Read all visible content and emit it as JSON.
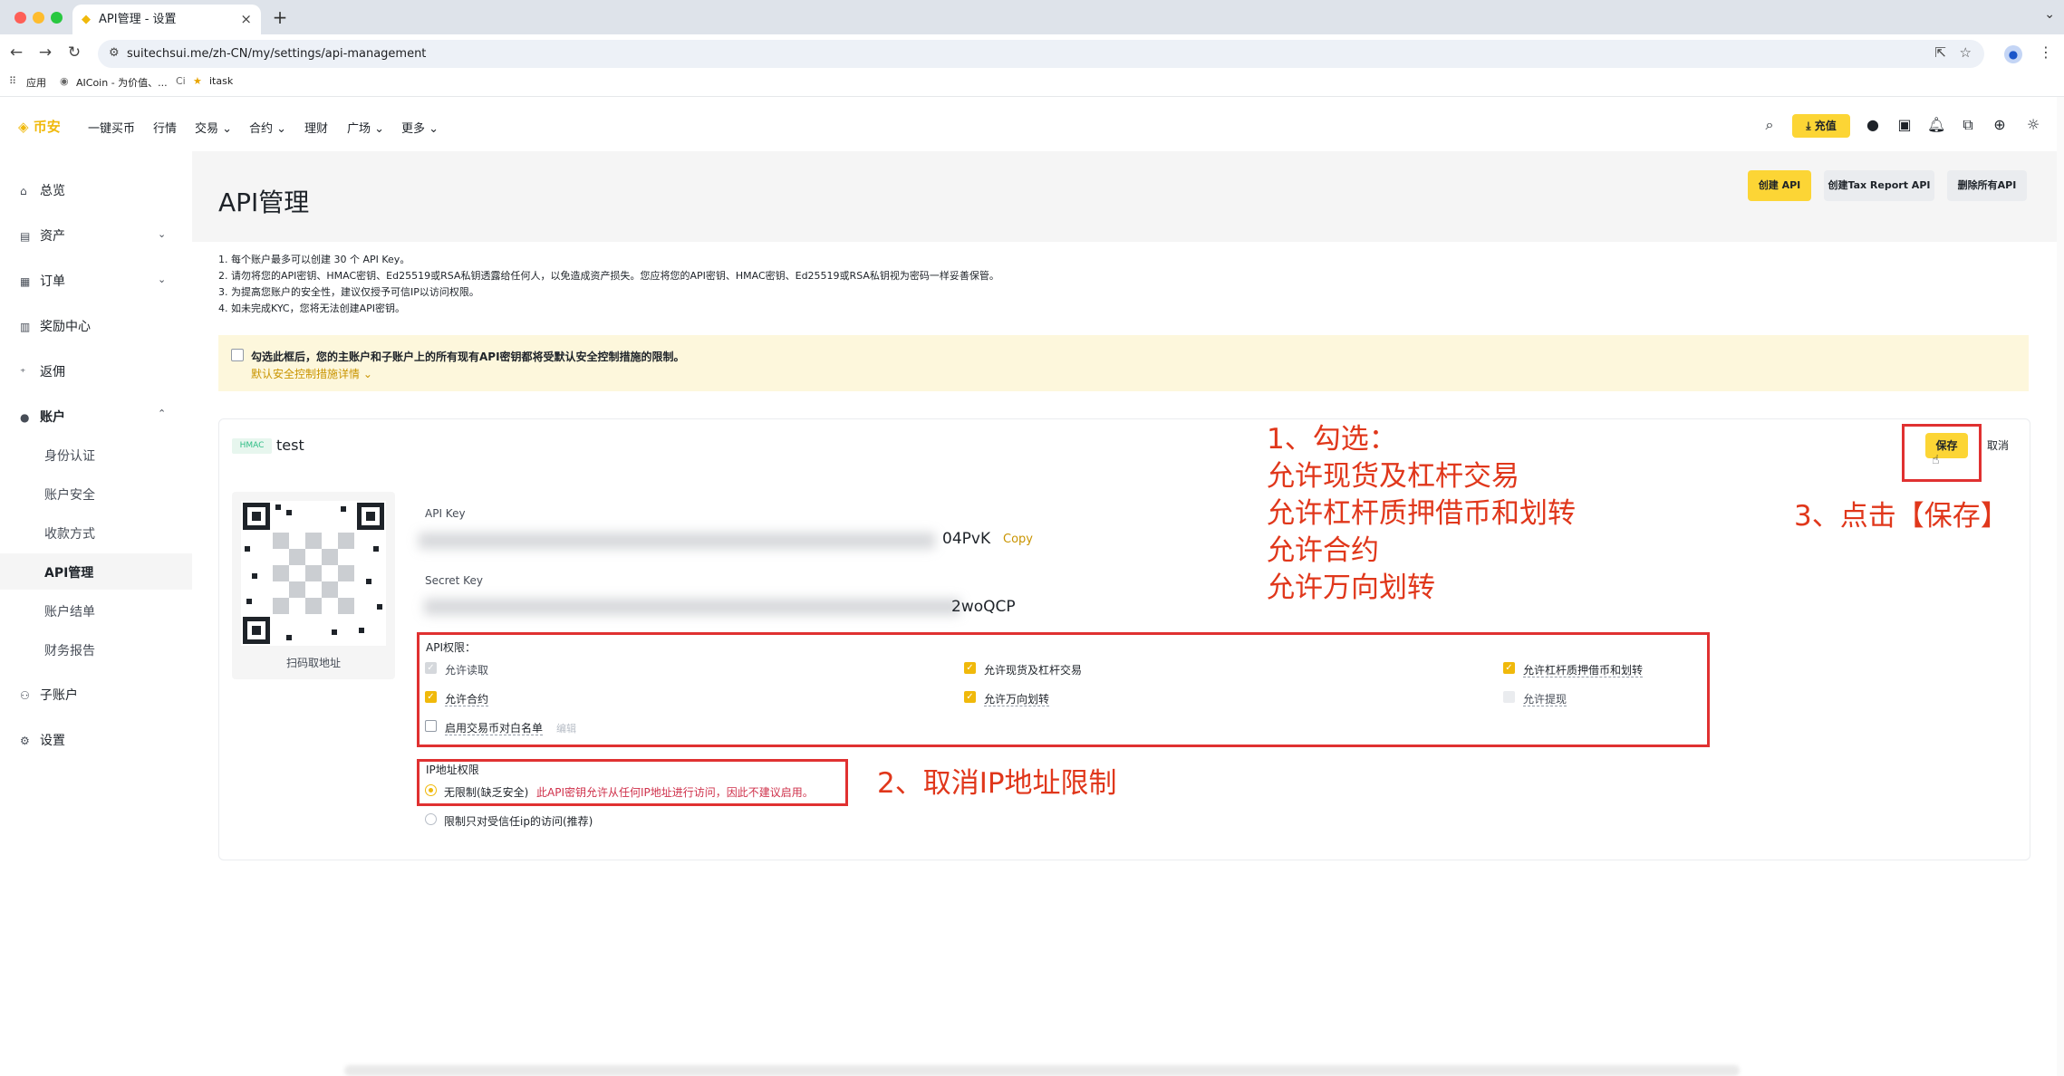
{
  "browser": {
    "tab_title": "API管理 - 设置",
    "url": "suitechsui.me/zh-CN/my/settings/api-management",
    "bookmarks": [
      "应用",
      "AICoin - 为价值、...",
      "Ci",
      "itask"
    ]
  },
  "header": {
    "logo": "币安",
    "nav": [
      "一键买币",
      "行情",
      "交易",
      "合约",
      "理财",
      "广场",
      "更多"
    ],
    "deposit_label": "充值"
  },
  "sidebar": {
    "items": [
      "总览",
      "资产",
      "订单",
      "奖励中心",
      "返佣",
      "账户"
    ],
    "account_sub": [
      "身份认证",
      "账户安全",
      "收款方式",
      "API管理",
      "账户结单",
      "财务报告"
    ],
    "bottom_items": [
      "子账户",
      "设置"
    ]
  },
  "page": {
    "title": "API管理",
    "buttons": {
      "create": "创建 API",
      "tax": "创建Tax Report API",
      "delete_all": "删除所有API"
    },
    "notes": [
      "1. 每个账户最多可以创建 30 个 API Key。",
      "2. 请勿将您的API密钥、HMAC密钥、Ed25519或RSA私钥透露给任何人，以免造成资产损失。您应将您的API密钥、HMAC密钥、Ed25519或RSA私钥视为密码一样妥善保管。",
      "3. 为提高您账户的安全性，建议仅授予可信IP以访问权限。",
      "4. 如未完成KYC，您将无法创建API密钥。"
    ],
    "warning": {
      "text": "勾选此框后，您的主账户和子账户上的所有现有API密钥都将受默认安全控制措施的限制。",
      "link": "默认安全控制措施详情"
    }
  },
  "card": {
    "badge": "HMAC",
    "name": "test",
    "qr_caption": "扫码取地址",
    "api_key_label": "API Key",
    "api_key_tail": "04PvK",
    "copy": "Copy",
    "secret_key_label": "Secret Key",
    "secret_key_tail": "2woQCP",
    "save": "保存",
    "cancel": "取消",
    "permissions_label": "API权限：",
    "permissions": [
      {
        "label": "允许读取",
        "state": "disabled-checked"
      },
      {
        "label": "允许现货及杠杆交易",
        "state": "checked"
      },
      {
        "label": "允许杠杆质押借币和划转",
        "state": "checked"
      },
      {
        "label": "允许合约",
        "state": "checked"
      },
      {
        "label": "允许万向划转",
        "state": "checked"
      },
      {
        "label": "允许提现",
        "state": "disabled"
      },
      {
        "label": "启用交易币对白名单",
        "state": "unchecked"
      }
    ],
    "edit": "编辑",
    "ip_label": "IP地址权限",
    "ip_unrestricted": "无限制(缺乏安全)",
    "ip_warning": "此API密钥允许从任何IP地址进行访问，因此不建议启用。",
    "ip_restricted": "限制只对受信任ip的访问(推荐)"
  },
  "annotations": {
    "step1": [
      "1、勾选：",
      "允许现货及杠杆交易",
      "允许杠杆质押借币和划转",
      "允许合约",
      "允许万向划转"
    ],
    "step2": "2、取消IP地址限制",
    "step3": "3、点击【保存】"
  },
  "colors": {
    "brand": "#f0b90b",
    "button": "#fcd535",
    "annotation": "#e0371b"
  }
}
